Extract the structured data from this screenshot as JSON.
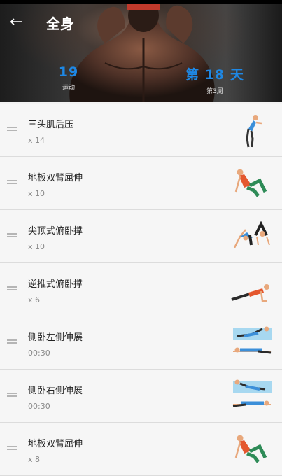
{
  "header": {
    "title": "全身",
    "stats": [
      {
        "value": "19",
        "label": "运动"
      },
      {
        "value": "第 18 天",
        "label": "第3周"
      }
    ]
  },
  "exercises": [
    {
      "name": "三头肌后压",
      "count": "x 14",
      "icon": "triceps-figure-icon"
    },
    {
      "name": "地板双臂屈伸",
      "count": "x 10",
      "icon": "floor-dip-figure-icon"
    },
    {
      "name": "尖顶式俯卧撑",
      "count": "x 10",
      "icon": "pike-pushup-figure-icon"
    },
    {
      "name": "逆推式俯卧撑",
      "count": "x 6",
      "icon": "pushup-figure-icon"
    },
    {
      "name": "侧卧左侧伸展",
      "count": "00:30",
      "icon": "side-stretch-left-figure-icon"
    },
    {
      "name": "侧卧右侧伸展",
      "count": "00:30",
      "icon": "side-stretch-right-figure-icon"
    },
    {
      "name": "地板双臂屈伸",
      "count": "x 8",
      "icon": "floor-dip-figure-icon"
    }
  ],
  "colors": {
    "accent": "#1e88e5",
    "shirt_orange": "#e4572e",
    "shirt_blue": "#3b8fd9"
  }
}
